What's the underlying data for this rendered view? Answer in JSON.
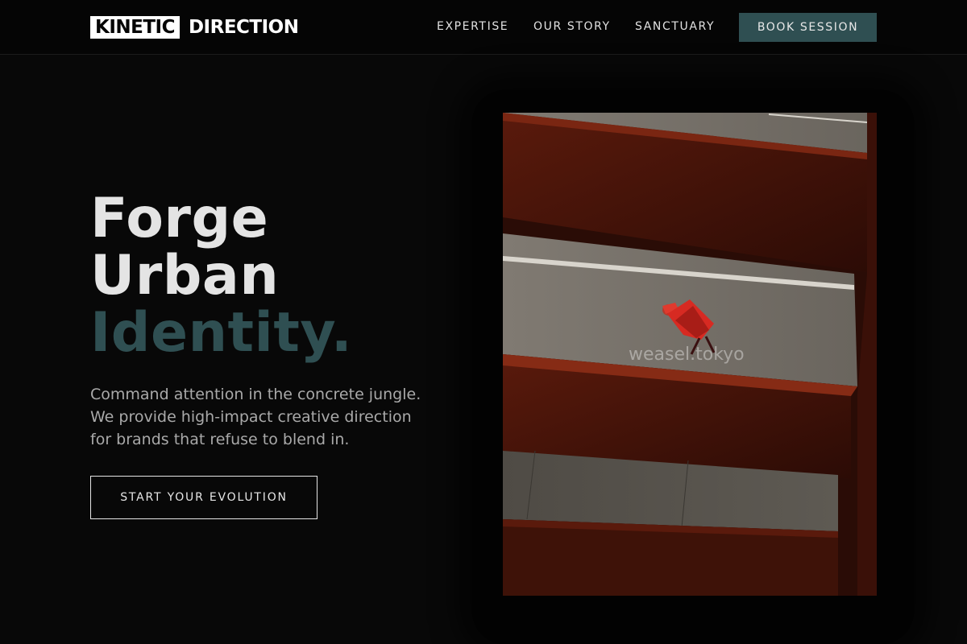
{
  "brand": {
    "box_text": "KINETIC",
    "word": "DIRECTION"
  },
  "nav": {
    "links": [
      "EXPERTISE",
      "OUR STORY",
      "SANCTUARY"
    ],
    "cta_label": "BOOK SESSION"
  },
  "hero": {
    "title_lines": [
      "Forge",
      "Urban"
    ],
    "title_accent": "Identity.",
    "subtitle_lines": [
      "Command attention in the concrete jungle.",
      "We provide high-impact creative direction",
      "for brands that refuse to blend in."
    ],
    "cta_label": "START YOUR EVOLUTION"
  },
  "photo": {
    "watermark": "weasel.tokyo",
    "subject_icon": "figure-in-red-dress-on-parking-ramp"
  },
  "colors": {
    "background": "#080808",
    "accent": "#2f4f52",
    "text": "#e4e4e4",
    "muted_text": "#a9a9a9",
    "photo_red": "#7a2612"
  }
}
